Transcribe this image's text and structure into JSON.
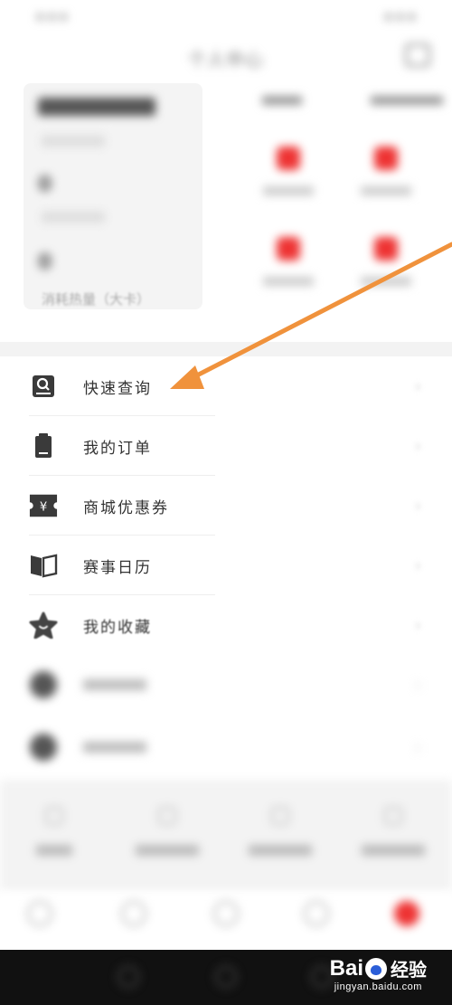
{
  "status_bar": {
    "left": "▪ ▪ ▪",
    "right": "▪ ▪ ▪"
  },
  "header": {
    "title": "个人中心"
  },
  "stats": [
    {
      "value": "0"
    },
    {
      "value": "0"
    },
    {
      "value": "0",
      "label": "消耗热量（大卡）"
    }
  ],
  "menu": {
    "items": [
      {
        "label": "快速查询",
        "icon": "search-card-icon"
      },
      {
        "label": "我的订单",
        "icon": "clipboard-icon"
      },
      {
        "label": "商城优惠券",
        "icon": "yuan-coupon-icon"
      },
      {
        "label": "赛事日历",
        "icon": "book-icon"
      },
      {
        "label": "我的收藏",
        "icon": "star-icon"
      }
    ],
    "chevron": "›"
  },
  "watermark": {
    "brand_left": "Bai",
    "brand_right": "经验",
    "site": "jingyan.baidu.com"
  },
  "colors": {
    "accent": "#e33333",
    "arrow": "#f0923c",
    "icon_dark": "#3a3a3a"
  }
}
